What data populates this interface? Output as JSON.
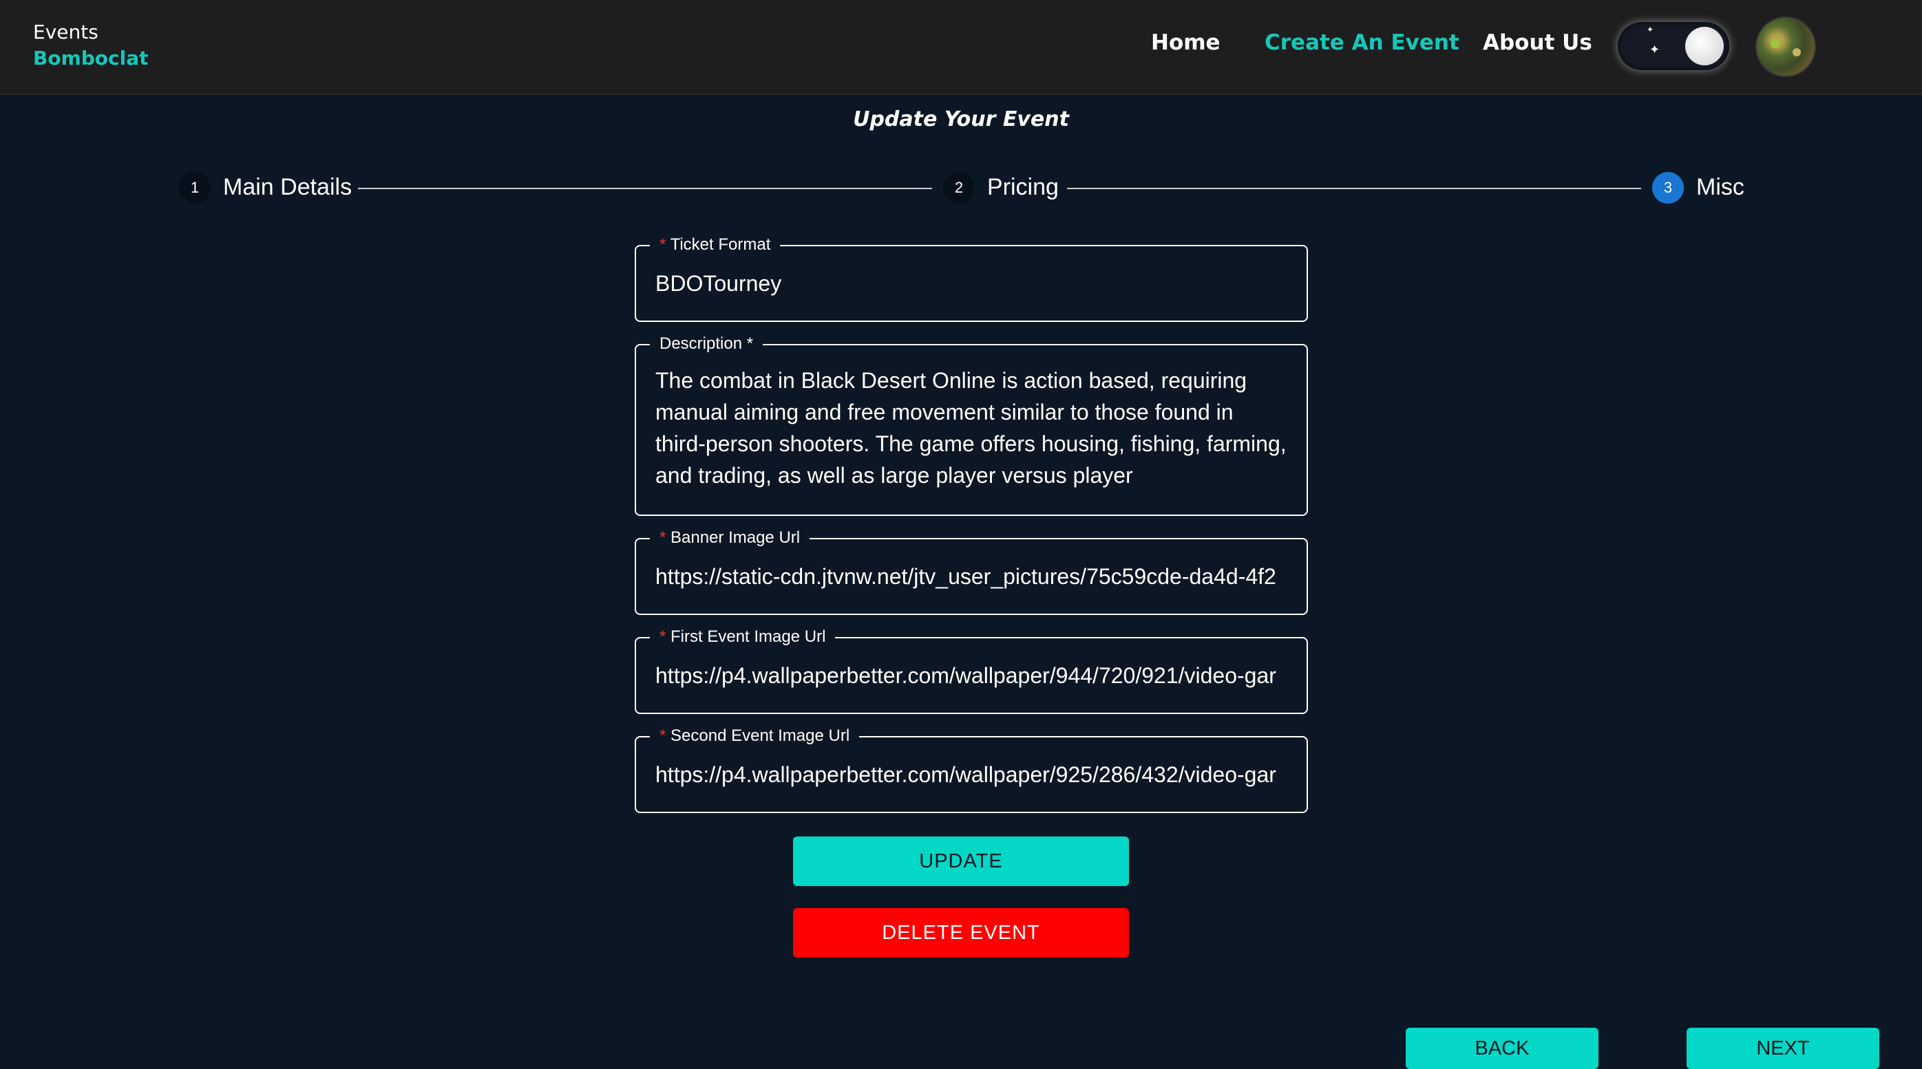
{
  "header": {
    "brand_line1": "Events",
    "brand_line2": "Bomboclat",
    "nav": {
      "home": "Home",
      "create": "Create An Event",
      "about": "About Us"
    },
    "theme_toggle_state": "dark"
  },
  "page_title": "Update Your Event",
  "stepper": {
    "steps": [
      {
        "number": "1",
        "label": "Main Details"
      },
      {
        "number": "2",
        "label": "Pricing"
      },
      {
        "number": "3",
        "label": "Misc"
      }
    ],
    "active_step": 3
  },
  "form": {
    "ticket_format": {
      "label": "Ticket Format",
      "required_mark": "*",
      "value": "BDOTourney"
    },
    "description": {
      "label": "Description *",
      "value": "The combat in Black Desert Online is action based, requiring manual aiming and free movement similar to those found in third-person shooters. The game offers housing, fishing, farming, and trading, as well as large player versus player"
    },
    "banner_image_url": {
      "label": "Banner Image Url",
      "required_mark": "*",
      "value": "https://static-cdn.jtvnw.net/jtv_user_pictures/75c59cde-da4d-4f2"
    },
    "first_event_image_url": {
      "label": "First Event Image Url",
      "required_mark": "*",
      "value": "https://p4.wallpaperbetter.com/wallpaper/944/720/921/video-gar"
    },
    "second_event_image_url": {
      "label": "Second Event Image Url",
      "required_mark": "*",
      "value": "https://p4.wallpaperbetter.com/wallpaper/925/286/432/video-gar"
    }
  },
  "buttons": {
    "update": "UPDATE",
    "delete": "DELETE EVENT",
    "back": "BACK",
    "next": "NEXT"
  },
  "colors": {
    "accent": "#03d8c6",
    "danger": "#ff0000",
    "background": "#0b1724",
    "header": "#1e1e1e",
    "step_active": "#1976d2"
  }
}
